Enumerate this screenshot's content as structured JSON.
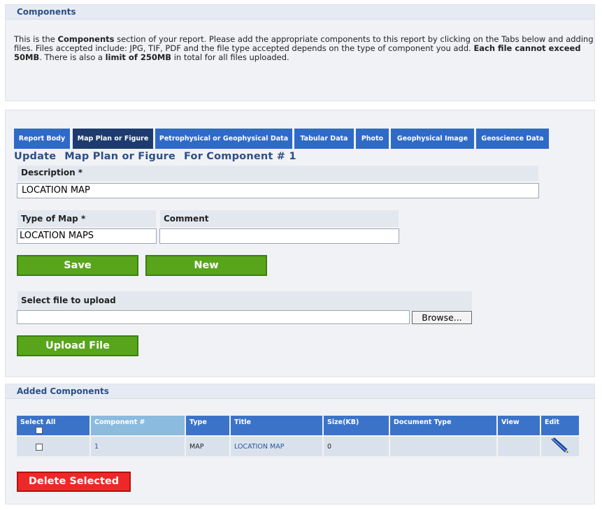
{
  "intro": {
    "title": "Components",
    "text_1": "This is the ",
    "text_2": "Components",
    "text_3": " section of your report. Please add the appropriate components to this report by clicking on the Tabs below and adding files. Files accepted include: JPG, TIF, PDF and the file type accepted depends on the type of component you add. ",
    "text_4": "Each file cannot exceed 50MB",
    "text_5": ". There is also a ",
    "text_6": "limit of 250MB",
    "text_7": " in total for all files uploaded."
  },
  "tabs": [
    {
      "label": "Report Body",
      "active": false
    },
    {
      "label": "Map Plan or Figure",
      "active": true
    },
    {
      "label": "Petrophysical or Geophysical Data",
      "active": false
    },
    {
      "label": "Tabular Data",
      "active": false
    },
    {
      "label": "Photo",
      "active": false
    },
    {
      "label": "Geophysical Image",
      "active": false
    },
    {
      "label": "Geoscience Data",
      "active": false
    }
  ],
  "form": {
    "heading_action": "Update",
    "heading_type": "Map Plan or Figure",
    "heading_component": "For Component # 1",
    "description_label": "Description *",
    "description_value": "LOCATION MAP",
    "type_label": "Type of Map *",
    "type_value": "LOCATION MAPS",
    "comment_label": "Comment",
    "comment_value": "",
    "save_label": "Save",
    "new_label": "New",
    "upload_section_label": "Select file to upload",
    "file_value": "",
    "browse_label": "Browse...",
    "upload_label": "Upload File"
  },
  "added": {
    "title": "Added Components",
    "columns": [
      "Select All",
      "Component #",
      "Type",
      "Title",
      "Size(KB)",
      "Document Type",
      "View",
      "Edit"
    ],
    "rows": [
      {
        "component": "1",
        "type": "MAP",
        "title": "LOCATION MAP",
        "size": "0",
        "document_type": "",
        "view": "",
        "edit_icon": "pencil-icon"
      }
    ],
    "delete_label": "Delete Selected"
  },
  "colors": {
    "tab": "#2f6ac7",
    "tab_active": "#1d3b6e",
    "button_green": "#58a51c",
    "button_red": "#ee2828",
    "heading": "#2c4f87"
  }
}
